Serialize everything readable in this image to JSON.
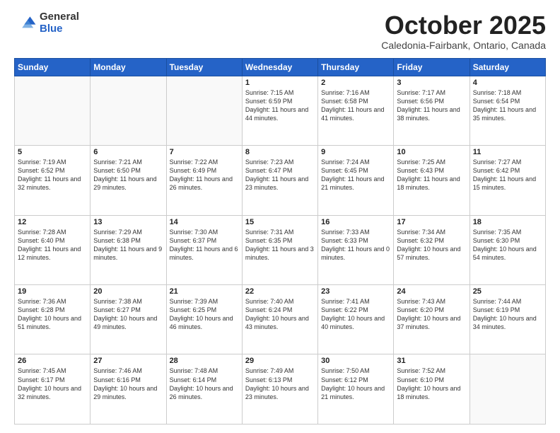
{
  "logo": {
    "general": "General",
    "blue": "Blue"
  },
  "header": {
    "month": "October 2025",
    "location": "Caledonia-Fairbank, Ontario, Canada"
  },
  "days_of_week": [
    "Sunday",
    "Monday",
    "Tuesday",
    "Wednesday",
    "Thursday",
    "Friday",
    "Saturday"
  ],
  "weeks": [
    [
      {
        "day": "",
        "info": ""
      },
      {
        "day": "",
        "info": ""
      },
      {
        "day": "",
        "info": ""
      },
      {
        "day": "1",
        "info": "Sunrise: 7:15 AM\nSunset: 6:59 PM\nDaylight: 11 hours\nand 44 minutes."
      },
      {
        "day": "2",
        "info": "Sunrise: 7:16 AM\nSunset: 6:58 PM\nDaylight: 11 hours\nand 41 minutes."
      },
      {
        "day": "3",
        "info": "Sunrise: 7:17 AM\nSunset: 6:56 PM\nDaylight: 11 hours\nand 38 minutes."
      },
      {
        "day": "4",
        "info": "Sunrise: 7:18 AM\nSunset: 6:54 PM\nDaylight: 11 hours\nand 35 minutes."
      }
    ],
    [
      {
        "day": "5",
        "info": "Sunrise: 7:19 AM\nSunset: 6:52 PM\nDaylight: 11 hours\nand 32 minutes."
      },
      {
        "day": "6",
        "info": "Sunrise: 7:21 AM\nSunset: 6:50 PM\nDaylight: 11 hours\nand 29 minutes."
      },
      {
        "day": "7",
        "info": "Sunrise: 7:22 AM\nSunset: 6:49 PM\nDaylight: 11 hours\nand 26 minutes."
      },
      {
        "day": "8",
        "info": "Sunrise: 7:23 AM\nSunset: 6:47 PM\nDaylight: 11 hours\nand 23 minutes."
      },
      {
        "day": "9",
        "info": "Sunrise: 7:24 AM\nSunset: 6:45 PM\nDaylight: 11 hours\nand 21 minutes."
      },
      {
        "day": "10",
        "info": "Sunrise: 7:25 AM\nSunset: 6:43 PM\nDaylight: 11 hours\nand 18 minutes."
      },
      {
        "day": "11",
        "info": "Sunrise: 7:27 AM\nSunset: 6:42 PM\nDaylight: 11 hours\nand 15 minutes."
      }
    ],
    [
      {
        "day": "12",
        "info": "Sunrise: 7:28 AM\nSunset: 6:40 PM\nDaylight: 11 hours\nand 12 minutes."
      },
      {
        "day": "13",
        "info": "Sunrise: 7:29 AM\nSunset: 6:38 PM\nDaylight: 11 hours\nand 9 minutes."
      },
      {
        "day": "14",
        "info": "Sunrise: 7:30 AM\nSunset: 6:37 PM\nDaylight: 11 hours\nand 6 minutes."
      },
      {
        "day": "15",
        "info": "Sunrise: 7:31 AM\nSunset: 6:35 PM\nDaylight: 11 hours\nand 3 minutes."
      },
      {
        "day": "16",
        "info": "Sunrise: 7:33 AM\nSunset: 6:33 PM\nDaylight: 11 hours\nand 0 minutes."
      },
      {
        "day": "17",
        "info": "Sunrise: 7:34 AM\nSunset: 6:32 PM\nDaylight: 10 hours\nand 57 minutes."
      },
      {
        "day": "18",
        "info": "Sunrise: 7:35 AM\nSunset: 6:30 PM\nDaylight: 10 hours\nand 54 minutes."
      }
    ],
    [
      {
        "day": "19",
        "info": "Sunrise: 7:36 AM\nSunset: 6:28 PM\nDaylight: 10 hours\nand 51 minutes."
      },
      {
        "day": "20",
        "info": "Sunrise: 7:38 AM\nSunset: 6:27 PM\nDaylight: 10 hours\nand 49 minutes."
      },
      {
        "day": "21",
        "info": "Sunrise: 7:39 AM\nSunset: 6:25 PM\nDaylight: 10 hours\nand 46 minutes."
      },
      {
        "day": "22",
        "info": "Sunrise: 7:40 AM\nSunset: 6:24 PM\nDaylight: 10 hours\nand 43 minutes."
      },
      {
        "day": "23",
        "info": "Sunrise: 7:41 AM\nSunset: 6:22 PM\nDaylight: 10 hours\nand 40 minutes."
      },
      {
        "day": "24",
        "info": "Sunrise: 7:43 AM\nSunset: 6:20 PM\nDaylight: 10 hours\nand 37 minutes."
      },
      {
        "day": "25",
        "info": "Sunrise: 7:44 AM\nSunset: 6:19 PM\nDaylight: 10 hours\nand 34 minutes."
      }
    ],
    [
      {
        "day": "26",
        "info": "Sunrise: 7:45 AM\nSunset: 6:17 PM\nDaylight: 10 hours\nand 32 minutes."
      },
      {
        "day": "27",
        "info": "Sunrise: 7:46 AM\nSunset: 6:16 PM\nDaylight: 10 hours\nand 29 minutes."
      },
      {
        "day": "28",
        "info": "Sunrise: 7:48 AM\nSunset: 6:14 PM\nDaylight: 10 hours\nand 26 minutes."
      },
      {
        "day": "29",
        "info": "Sunrise: 7:49 AM\nSunset: 6:13 PM\nDaylight: 10 hours\nand 23 minutes."
      },
      {
        "day": "30",
        "info": "Sunrise: 7:50 AM\nSunset: 6:12 PM\nDaylight: 10 hours\nand 21 minutes."
      },
      {
        "day": "31",
        "info": "Sunrise: 7:52 AM\nSunset: 6:10 PM\nDaylight: 10 hours\nand 18 minutes."
      },
      {
        "day": "",
        "info": ""
      }
    ]
  ]
}
